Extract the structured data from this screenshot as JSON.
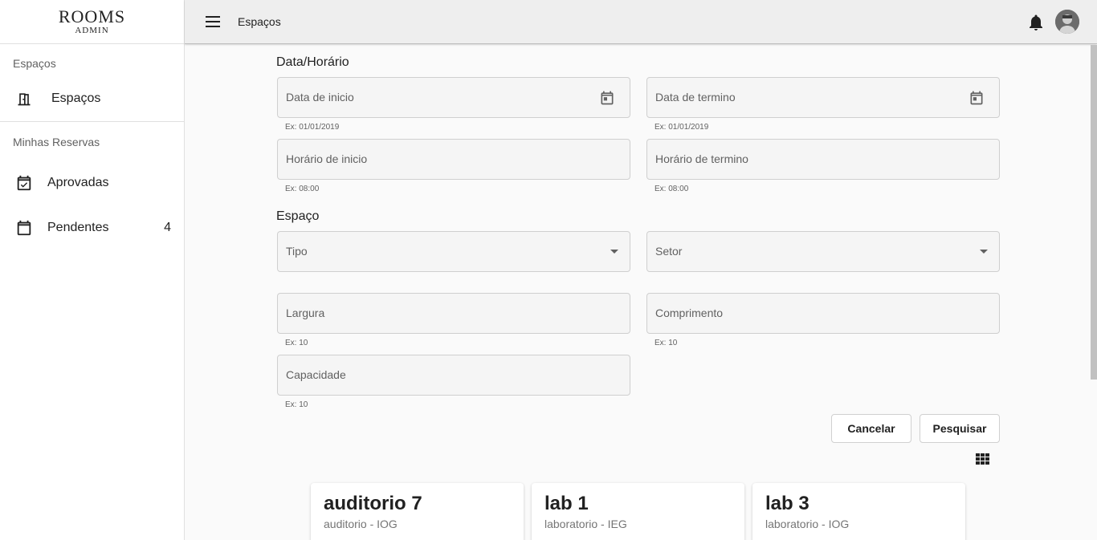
{
  "logo": {
    "title": "ROOMS",
    "subtitle": "ADMIN"
  },
  "sidebar": {
    "section1_label": "Espaços",
    "section1_items": [
      {
        "label": "Espaços",
        "icon": "door-icon"
      }
    ],
    "section2_label": "Minhas Reservas",
    "section2_items": [
      {
        "label": "Aprovadas",
        "icon": "event-available-icon"
      },
      {
        "label": "Pendentes",
        "icon": "calendar-icon",
        "count": "4"
      }
    ]
  },
  "appbar": {
    "title": "Espaços"
  },
  "form": {
    "datetime_title": "Data/Horário",
    "start_date": {
      "label": "Data de inicio",
      "hint": "Ex: 01/01/2019"
    },
    "end_date": {
      "label": "Data de termino",
      "hint": "Ex: 01/01/2019"
    },
    "start_time": {
      "label": "Horário de inicio",
      "hint": "Ex: 08:00"
    },
    "end_time": {
      "label": "Horário de termino",
      "hint": "Ex: 08:00"
    },
    "space_title": "Espaço",
    "type": {
      "label": "Tipo"
    },
    "sector": {
      "label": "Setor"
    },
    "width": {
      "label": "Largura",
      "hint": "Ex: 10"
    },
    "length": {
      "label": "Comprimento",
      "hint": "Ex: 10"
    },
    "capacity": {
      "label": "Capacidade",
      "hint": "Ex: 10"
    },
    "cancel_label": "Cancelar",
    "search_label": "Pesquisar"
  },
  "results": [
    {
      "title": "auditorio 7",
      "subtitle": "auditorio - IOG"
    },
    {
      "title": "lab 1",
      "subtitle": "laboratorio - IEG"
    },
    {
      "title": "lab 3",
      "subtitle": "laboratorio - IOG"
    }
  ],
  "colors": {
    "appbar_bg": "#eeeeee",
    "field_bg": "#f5f5f5",
    "text": "#212121",
    "muted": "#616161"
  }
}
